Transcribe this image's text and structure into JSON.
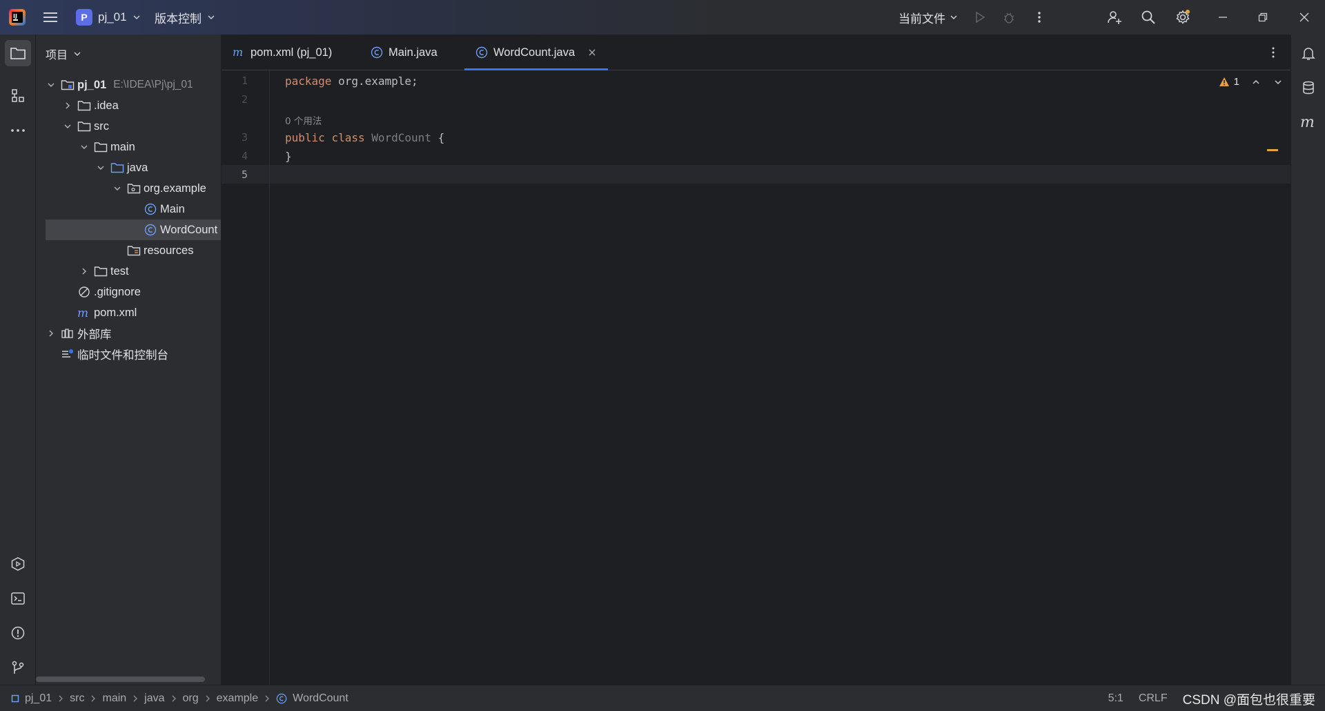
{
  "titlebar": {
    "project_badge": "P",
    "project_name": "pj_01",
    "vcs_label": "版本控制",
    "run_config": "当前文件"
  },
  "project_panel": {
    "header": "项目",
    "tree": [
      {
        "label": "pj_01",
        "path": "E:\\IDEA\\Pj\\pj_01"
      },
      {
        "label": ".idea"
      },
      {
        "label": "src"
      },
      {
        "label": "main"
      },
      {
        "label": "java"
      },
      {
        "label": "org.example"
      },
      {
        "label": "Main"
      },
      {
        "label": "WordCount"
      },
      {
        "label": "resources"
      },
      {
        "label": "test"
      },
      {
        "label": ".gitignore"
      },
      {
        "label": "pom.xml"
      },
      {
        "label": "外部库"
      },
      {
        "label": "临时文件和控制台"
      }
    ]
  },
  "tabs": [
    {
      "label": "pom.xml (pj_01)"
    },
    {
      "label": "Main.java"
    },
    {
      "label": "WordCount.java"
    }
  ],
  "editor": {
    "line_numbers": [
      "1",
      "2",
      "3",
      "4",
      "5"
    ],
    "line1": {
      "kw": "package",
      "rest": " org.example;"
    },
    "usage_hint": "0 个用法",
    "line3": {
      "kw1": "public",
      "kw2": "class",
      "name": "WordCount",
      "brace": " {"
    },
    "line4": "}",
    "warning_count": "1"
  },
  "statusbar": {
    "breadcrumbs": [
      "pj_01",
      "src",
      "main",
      "java",
      "org",
      "example",
      "WordCount"
    ],
    "position": "5:1",
    "line_sep": "CRLF",
    "watermark": "CSDN @面包也很重要"
  },
  "colors": {
    "accent": "#3574f0",
    "keyword": "#cf8e6d",
    "class_icon": "#6c9ef8",
    "warning": "#e6a23c"
  }
}
